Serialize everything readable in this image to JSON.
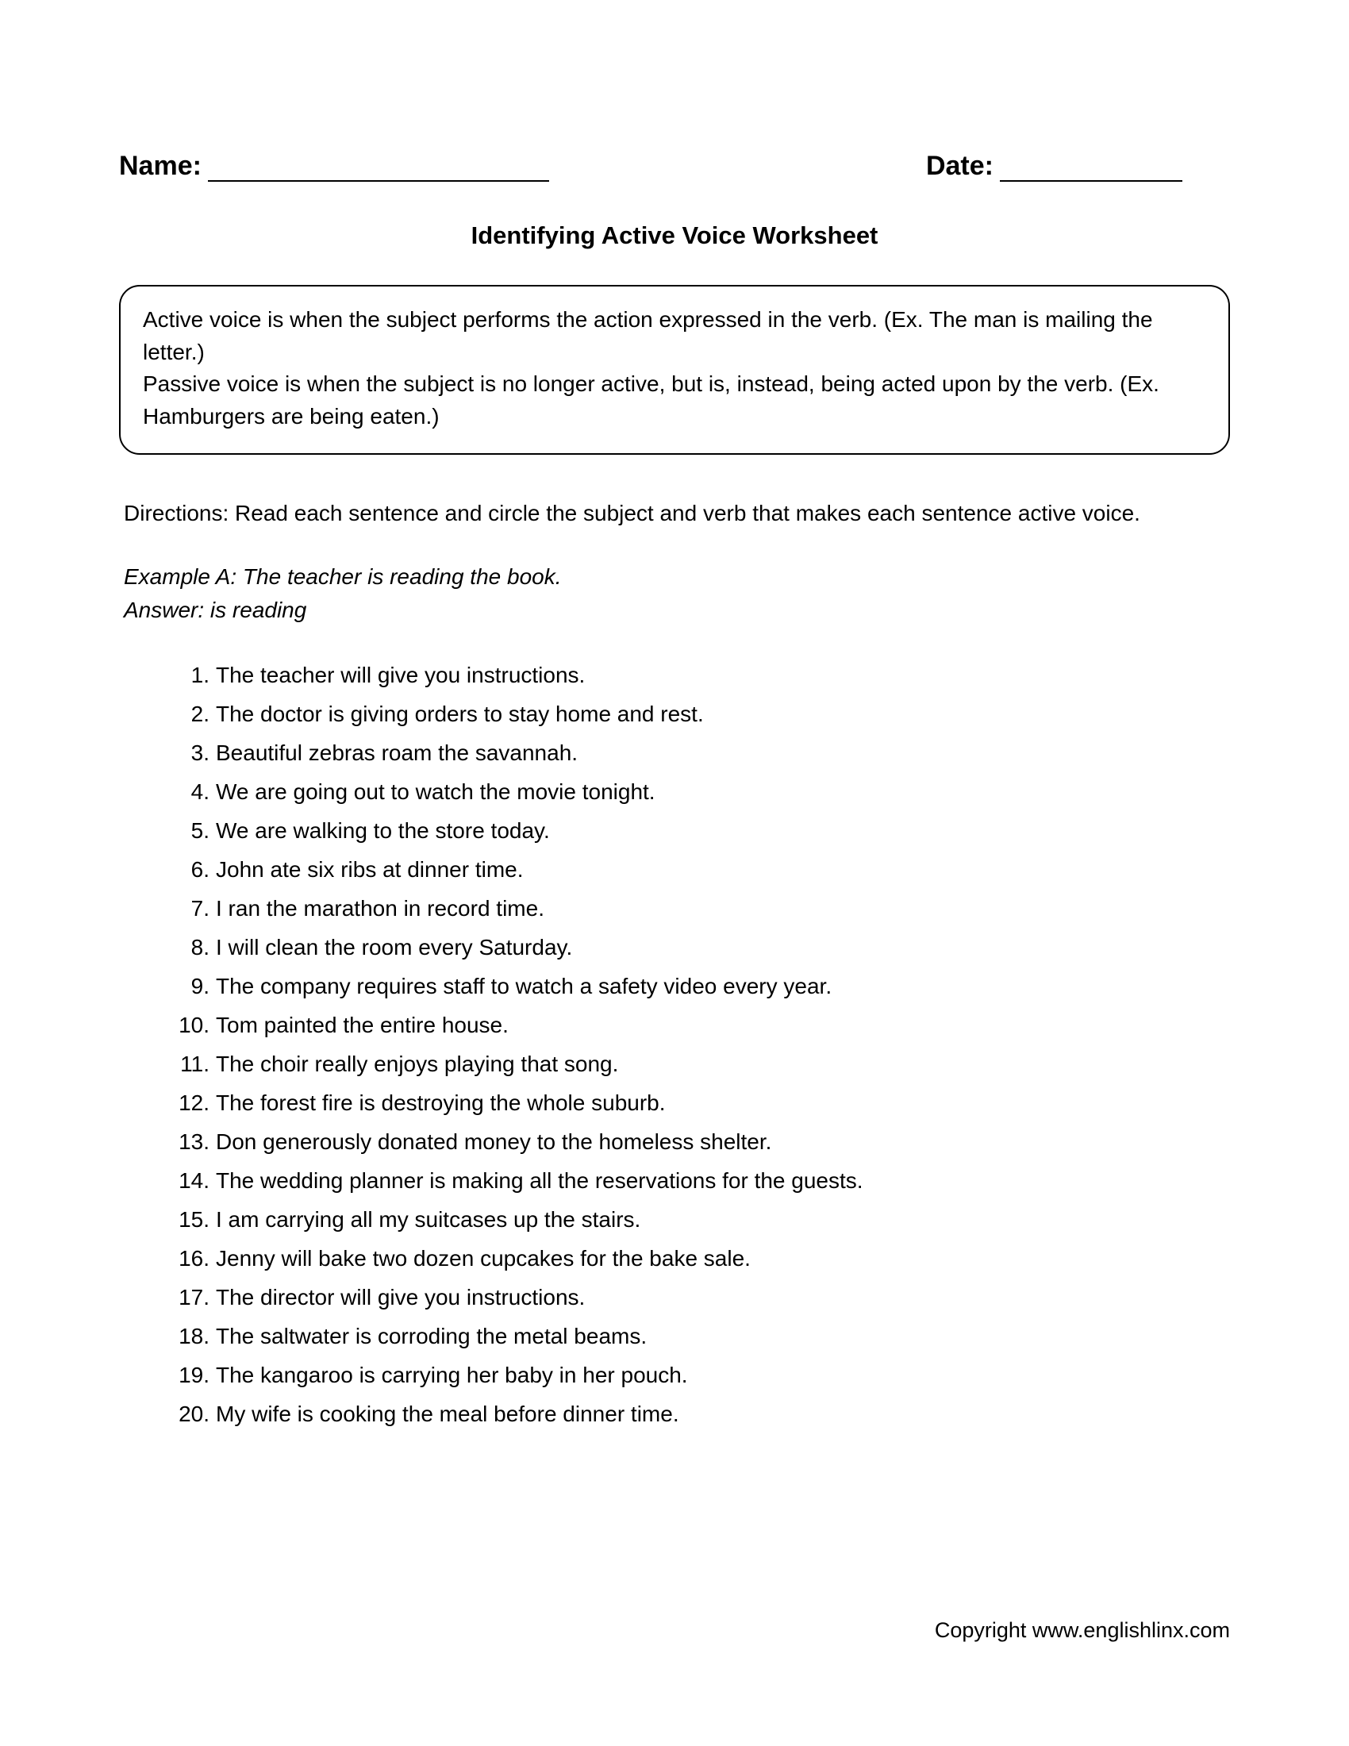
{
  "header": {
    "name_label": "Name:",
    "date_label": "Date:"
  },
  "title": "Identifying Active Voice Worksheet",
  "instruction_box": {
    "line1": "Active voice is when the subject performs the action expressed in the verb. (Ex. The man is mailing the letter.)",
    "line2": "Passive voice is when the subject is no longer active, but is, instead, being acted upon by the verb. (Ex. Hamburgers are being eaten.)"
  },
  "directions": "Directions: Read each sentence and circle the subject and verb that makes each sentence active voice.",
  "example": {
    "line1": "Example A: The teacher is reading the book.",
    "line2": "Answer: is reading"
  },
  "items": [
    "The teacher will give you instructions.",
    "The doctor is giving orders to stay home and rest.",
    "Beautiful zebras roam the savannah.",
    "We are going out to watch the movie tonight.",
    "We are walking to the store today.",
    "John ate six ribs at dinner time.",
    "I ran the marathon in record time.",
    "I will clean the room every Saturday.",
    "The company requires staff to watch a safety video every year.",
    "Tom painted the entire house.",
    "The choir really enjoys playing that song.",
    "The forest fire is destroying the whole suburb.",
    "Don generously donated money to the homeless shelter.",
    "The wedding planner is making all the reservations for the guests.",
    "I am carrying all my suitcases up the stairs.",
    "Jenny will bake two dozen cupcakes for the bake sale.",
    "The director will give you instructions.",
    "The saltwater is corroding the metal beams.",
    "The kangaroo is carrying her baby in her pouch.",
    "My wife is cooking the meal before dinner time."
  ],
  "footer": "Copyright www.englishlinx.com"
}
